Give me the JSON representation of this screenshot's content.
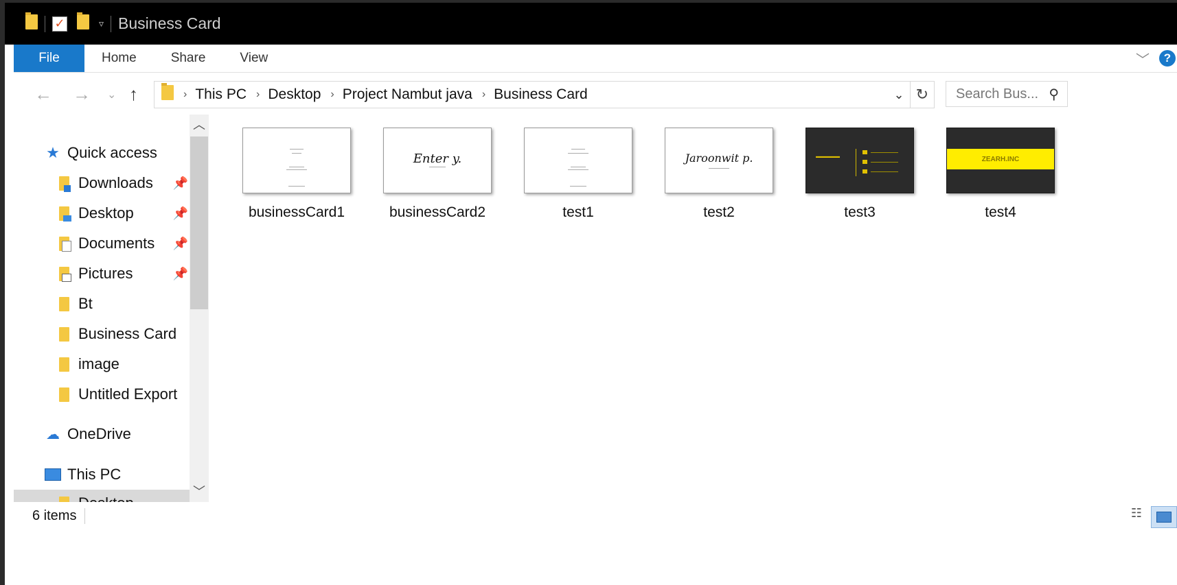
{
  "window": {
    "title": "Business Card"
  },
  "ribbon": {
    "file": "File",
    "tabs": [
      "Home",
      "Share",
      "View"
    ]
  },
  "address": {
    "crumbs": [
      "This PC",
      "Desktop",
      "Project Nambut java",
      "Business Card"
    ],
    "search_placeholder": "Search Bus..."
  },
  "navpane": {
    "quick_access": "Quick access",
    "items": [
      {
        "label": "Downloads",
        "pinned": true,
        "icon": "downloads-folder-icon"
      },
      {
        "label": "Desktop",
        "pinned": true,
        "icon": "desktop-folder-icon"
      },
      {
        "label": "Documents",
        "pinned": true,
        "icon": "documents-folder-icon"
      },
      {
        "label": "Pictures",
        "pinned": true,
        "icon": "pictures-folder-icon"
      },
      {
        "label": "Bt",
        "pinned": false,
        "icon": "folder-icon"
      },
      {
        "label": "Business Card",
        "pinned": false,
        "icon": "folder-icon"
      },
      {
        "label": "image",
        "pinned": false,
        "icon": "folder-icon"
      },
      {
        "label": "Untitled Export",
        "pinned": false,
        "icon": "folder-icon"
      }
    ],
    "onedrive": "OneDrive",
    "this_pc": "This PC",
    "partial": "Desktop"
  },
  "files": [
    {
      "name": "businessCard1",
      "style": "white-minimal"
    },
    {
      "name": "businessCard2",
      "style": "white-script",
      "script": "Enter y."
    },
    {
      "name": "test1",
      "style": "white-minimal"
    },
    {
      "name": "test2",
      "style": "white-script",
      "script": "Jaroonwit p."
    },
    {
      "name": "test3",
      "style": "dark"
    },
    {
      "name": "test4",
      "style": "dark-yellow",
      "band": "ZEARH.INC"
    }
  ],
  "status": {
    "count": "6 items"
  },
  "colors": {
    "accent": "#1979ca",
    "folder": "#f4c842",
    "titlebar": "#000000"
  }
}
